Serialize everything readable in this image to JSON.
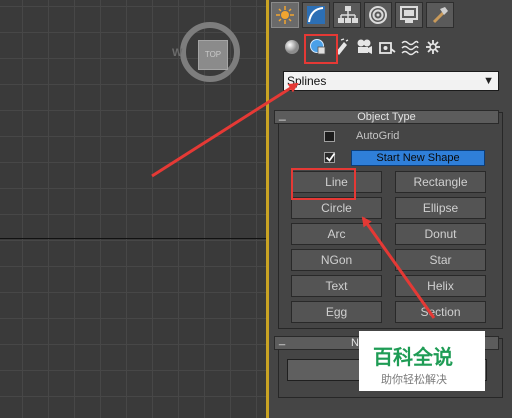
{
  "viewport": {
    "viewcube_face": "TOP",
    "compass_letter": "W"
  },
  "command_panel": {
    "tabs": [
      {
        "name": "create",
        "icon": "sun-star-icon",
        "active": true
      },
      {
        "name": "modify",
        "icon": "curve-icon"
      },
      {
        "name": "hierarchy",
        "icon": "hierarchy-icon"
      },
      {
        "name": "motion",
        "icon": "target-icon"
      },
      {
        "name": "display",
        "icon": "monitor-icon"
      },
      {
        "name": "utilities",
        "icon": "hammer-icon"
      }
    ],
    "categories": [
      {
        "name": "geometry",
        "icon": "sphere-icon"
      },
      {
        "name": "shapes",
        "icon": "shapes-icon",
        "active": true
      },
      {
        "name": "lights",
        "icon": "light-icon"
      },
      {
        "name": "cameras",
        "icon": "camera-icon"
      },
      {
        "name": "helpers",
        "icon": "helper-icon"
      },
      {
        "name": "space-warps",
        "icon": "wave-icon"
      },
      {
        "name": "systems",
        "icon": "gear-star-icon"
      }
    ],
    "dropdown_value": "Splines",
    "object_type": {
      "title": "Object Type",
      "autogrid_label": "AutoGrid",
      "start_new_shape_label": "Start New Shape",
      "buttons": [
        "Line",
        "Rectangle",
        "Circle",
        "Ellipse",
        "Arc",
        "Donut",
        "NGon",
        "Star",
        "Text",
        "Helix",
        "Egg",
        "Section"
      ]
    },
    "name_rollout_title": "Na"
  },
  "watermark": {
    "title": "百科全说",
    "subtitle": "助你轻松解决"
  },
  "colors": {
    "annotation_red": "#e53935",
    "start_shape_blue": "#2f7fd9",
    "viewport_border": "#c9a323"
  }
}
